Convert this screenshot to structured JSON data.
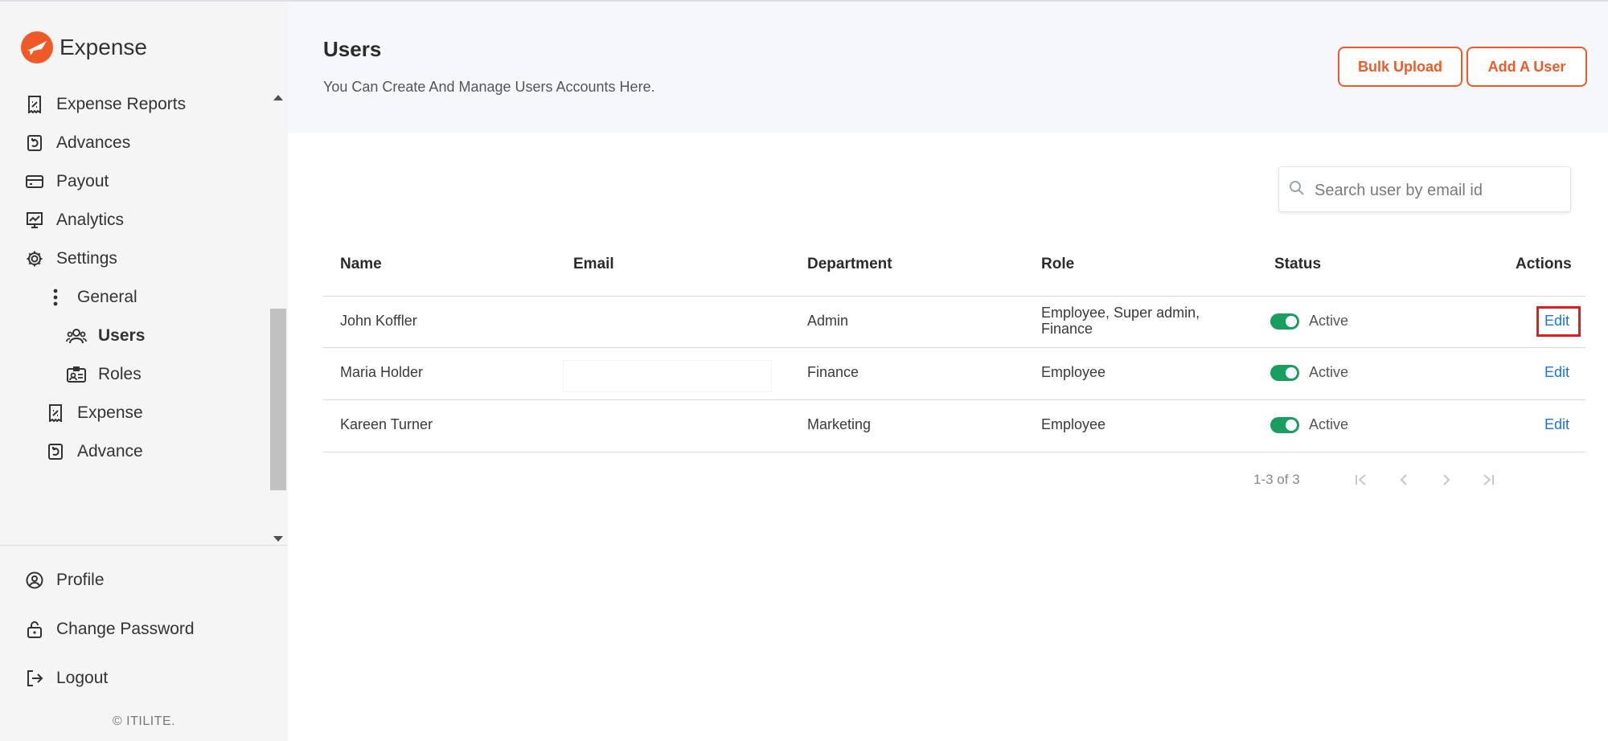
{
  "app": {
    "name": "Expense",
    "copyright": "© ITILITE."
  },
  "sidebar": {
    "items": [
      {
        "label": "Expense Reports",
        "icon": "receipt-icon"
      },
      {
        "label": "Advances",
        "icon": "advance-icon"
      },
      {
        "label": "Payout",
        "icon": "card-icon"
      },
      {
        "label": "Analytics",
        "icon": "chart-icon"
      },
      {
        "label": "Settings",
        "icon": "gear-icon"
      },
      {
        "label": "General",
        "icon": "kebab-icon"
      },
      {
        "label": "Users",
        "icon": "users-icon"
      },
      {
        "label": "Roles",
        "icon": "id-card-icon"
      },
      {
        "label": "Expense",
        "icon": "receipt-icon"
      },
      {
        "label": "Advance",
        "icon": "advance-icon"
      }
    ],
    "active": "Users",
    "bottom": [
      {
        "label": "Profile",
        "icon": "user-circle-icon"
      },
      {
        "label": "Change Password",
        "icon": "lock-icon"
      },
      {
        "label": "Logout",
        "icon": "logout-icon"
      }
    ]
  },
  "header": {
    "title": "Users",
    "subtitle": "You Can Create And Manage Users Accounts Here.",
    "bulk_upload": "Bulk Upload",
    "add_user": "Add A User"
  },
  "search": {
    "placeholder": "Search user by email id",
    "value": ""
  },
  "table": {
    "columns": [
      "Name",
      "Email",
      "Department",
      "Role",
      "Status",
      "Actions"
    ],
    "rows": [
      {
        "name": "John Koffler",
        "email": "",
        "department": "Admin",
        "role_line1": "Employee, Super admin,",
        "role_line2": "Finance",
        "status": "Active",
        "action": "Edit"
      },
      {
        "name": "Maria Holder",
        "email": "",
        "department": "Finance",
        "role_line1": "Employee",
        "role_line2": "",
        "status": "Active",
        "action": "Edit"
      },
      {
        "name": "Kareen Turner",
        "email": "",
        "department": "Marketing",
        "role_line1": "Employee",
        "role_line2": "",
        "status": "Active",
        "action": "Edit"
      }
    ]
  },
  "pagination": {
    "range": "1-3 of 3"
  },
  "colors": {
    "accent": "#f05a28",
    "toggle_on": "#1a9e5f",
    "link": "#1a73e8",
    "highlight": "#e11b22"
  }
}
